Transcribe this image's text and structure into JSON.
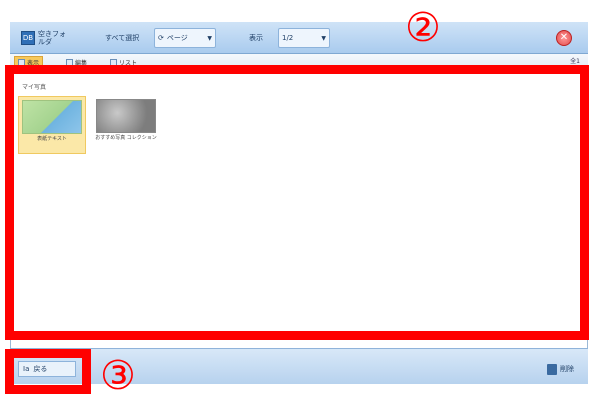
{
  "toolbar": {
    "folder_icon_text": "DB",
    "folder_label": "空きフォルダ",
    "select_all_label": "すべて選択",
    "action_dropdown_label": "ページ",
    "view_label": "表示",
    "view_dropdown_label": "1/2"
  },
  "subtoolbar": {
    "active_tab_label": "表示",
    "edit_label": "編集",
    "list_label": "リスト",
    "right_label": "全1"
  },
  "content": {
    "path_label": "マイ写真",
    "thumbnails": [
      {
        "caption": "表紙テキスト"
      },
      {
        "caption": "おすすめ写真 コレクション"
      }
    ]
  },
  "statusbar": {
    "restore_icon": "Ia",
    "restore_label": "戻る",
    "delete_label": "削除"
  },
  "annotations": {
    "label_2": "②",
    "label_3": "③",
    "color": "#ff0000"
  },
  "colors": {
    "toolbar": "#a9cbee",
    "accent": "#f7c95c"
  }
}
